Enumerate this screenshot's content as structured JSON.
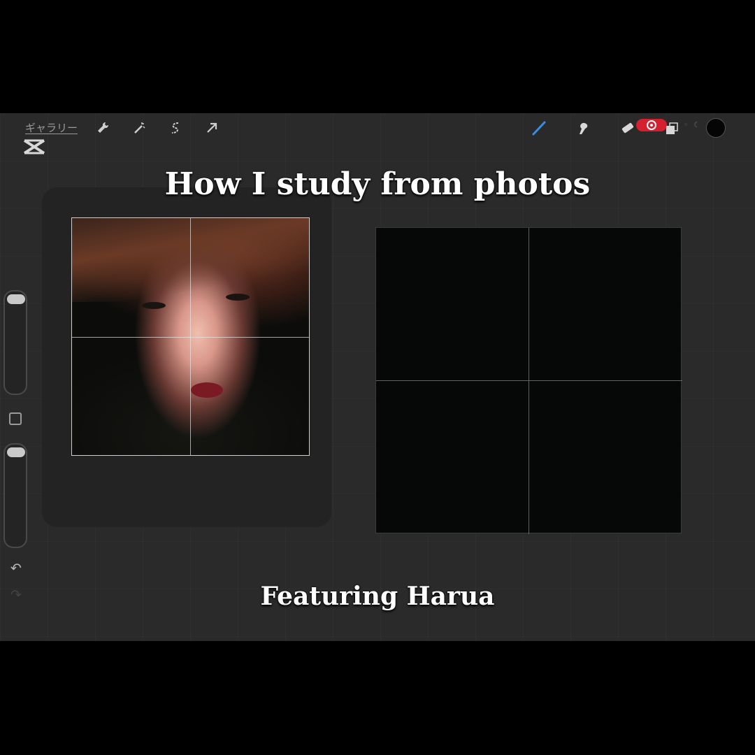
{
  "topbar": {
    "gallery_label": "ギャラリー",
    "left_tools": [
      "wrench-icon",
      "magic-wand-icon",
      "selection-icon",
      "transform-arrow-icon"
    ],
    "right_tools": [
      "brush-icon",
      "smudge-icon",
      "eraser-icon",
      "layers-icon"
    ],
    "recording_indicator_color": "#d4202f",
    "current_color": "#050505"
  },
  "sidebar": {
    "tools": [
      "brush-size-slider",
      "modify-button",
      "opacity-slider",
      "undo-icon",
      "redo-icon"
    ]
  },
  "overlay": {
    "title": "How I study from photos",
    "caption": "Featuring Harua"
  },
  "colors": {
    "background": "#000000",
    "app_background": "#2a2a2a",
    "canvas": "#060807",
    "accent_brush": "#3b8de0"
  }
}
